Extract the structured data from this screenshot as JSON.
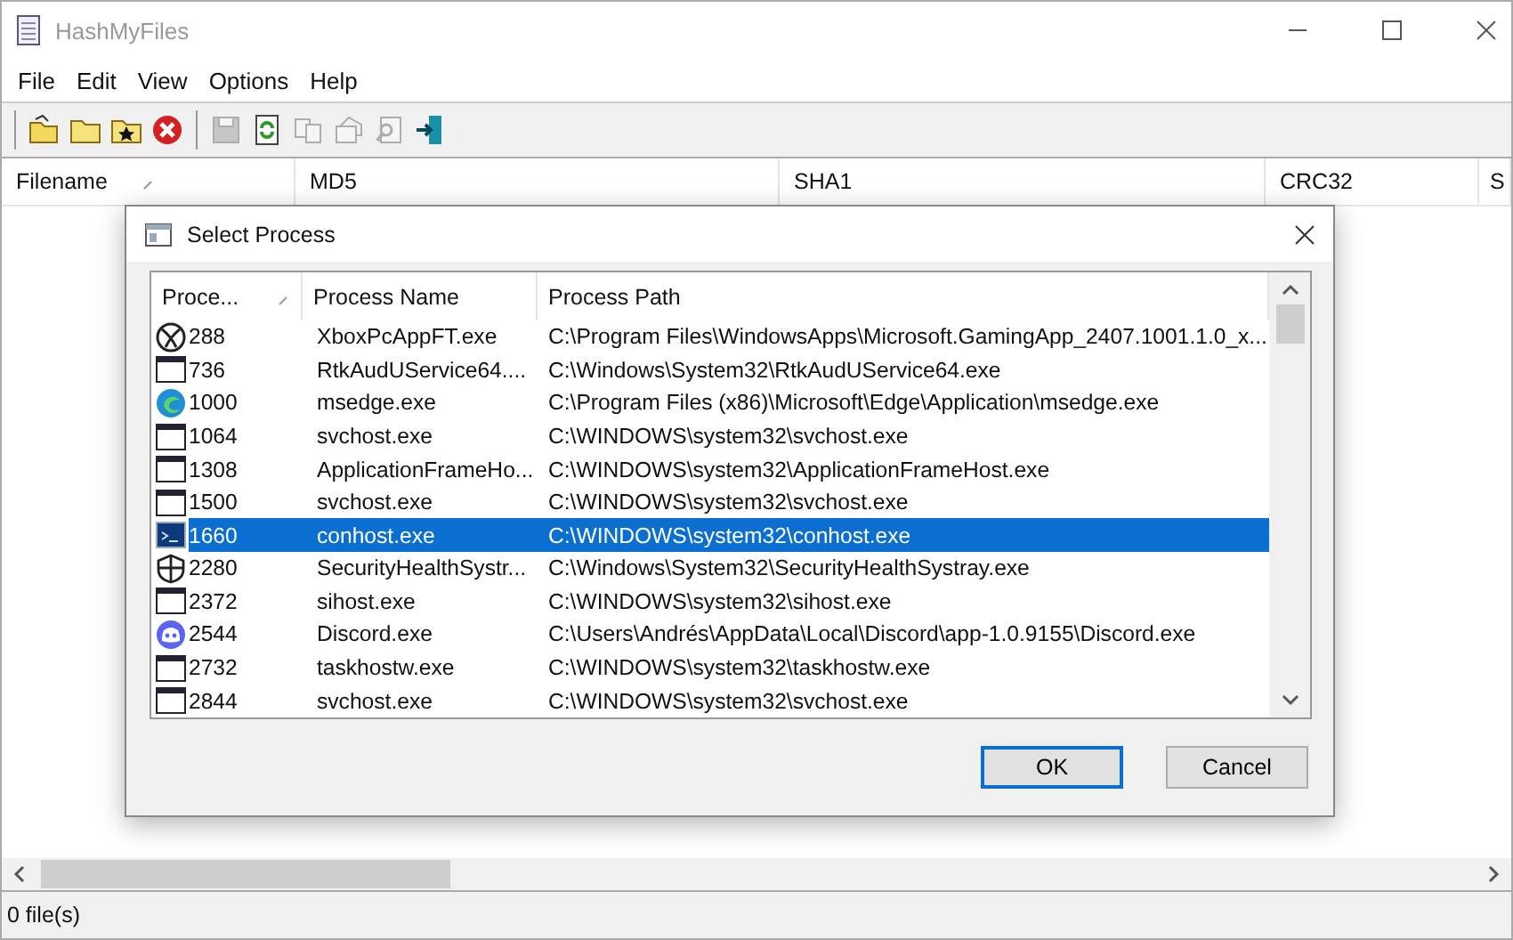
{
  "window": {
    "title": "HashMyFiles"
  },
  "menu": [
    "File",
    "Edit",
    "View",
    "Options",
    "Help"
  ],
  "toolbar": [
    {
      "disabled": false
    },
    {
      "disabled": false
    },
    {
      "disabled": false
    },
    {
      "disabled": false
    },
    {
      "disabled": true
    },
    {
      "disabled": false
    },
    {
      "disabled": true
    },
    {
      "disabled": true
    },
    {
      "disabled": true
    },
    {
      "disabled": false
    }
  ],
  "table": {
    "columns": [
      {
        "label": "Filename",
        "sorted": true
      },
      {
        "label": "MD5",
        "sorted": false
      },
      {
        "label": "SHA1",
        "sorted": false
      },
      {
        "label": "CRC32",
        "sorted": false
      },
      {
        "label": "S"
      }
    ]
  },
  "dialog": {
    "title": "Select Process",
    "columns": [
      {
        "label": "Proce...",
        "sorted": true
      },
      {
        "label": "Process Name",
        "sorted": false
      },
      {
        "label": "Process Path",
        "sorted": false
      }
    ],
    "rows": [
      {
        "kind": "xbox",
        "pid": "288",
        "name": "XboxPcAppFT.exe",
        "path": "C:\\Program Files\\WindowsApps\\Microsoft.GamingApp_2407.1001.1.0_x...",
        "selected": false
      },
      {
        "kind": "window",
        "pid": "736",
        "name": "RtkAudUService64....",
        "path": "C:\\Windows\\System32\\RtkAudUService64.exe",
        "selected": false
      },
      {
        "kind": "edge",
        "pid": "1000",
        "name": "msedge.exe",
        "path": "C:\\Program Files (x86)\\Microsoft\\Edge\\Application\\msedge.exe",
        "selected": false
      },
      {
        "kind": "window",
        "pid": "1064",
        "name": "svchost.exe",
        "path": "C:\\WINDOWS\\system32\\svchost.exe",
        "selected": false
      },
      {
        "kind": "window",
        "pid": "1308",
        "name": "ApplicationFrameHo...",
        "path": "C:\\WINDOWS\\system32\\ApplicationFrameHost.exe",
        "selected": false
      },
      {
        "kind": "window",
        "pid": "1500",
        "name": "svchost.exe",
        "path": "C:\\WINDOWS\\system32\\svchost.exe",
        "selected": false
      },
      {
        "kind": "console",
        "pid": "1660",
        "name": "conhost.exe",
        "path": "C:\\WINDOWS\\system32\\conhost.exe",
        "selected": true
      },
      {
        "kind": "shield",
        "pid": "2280",
        "name": "SecurityHealthSystr...",
        "path": "C:\\Windows\\System32\\SecurityHealthSystray.exe",
        "selected": false
      },
      {
        "kind": "window",
        "pid": "2372",
        "name": "sihost.exe",
        "path": "C:\\WINDOWS\\system32\\sihost.exe",
        "selected": false
      },
      {
        "kind": "discord",
        "pid": "2544",
        "name": "Discord.exe",
        "path": "C:\\Users\\Andrés\\AppData\\Local\\Discord\\app-1.0.9155\\Discord.exe",
        "selected": false
      },
      {
        "kind": "window",
        "pid": "2732",
        "name": "taskhostw.exe",
        "path": "C:\\WINDOWS\\system32\\taskhostw.exe",
        "selected": false
      },
      {
        "kind": "window",
        "pid": "2844",
        "name": "svchost.exe",
        "path": "C:\\WINDOWS\\system32\\svchost.exe",
        "selected": false
      }
    ],
    "buttons": [
      {
        "label": "OK",
        "default": true
      },
      {
        "label": "Cancel",
        "default": false
      }
    ]
  },
  "status_bar": "0 file(s)"
}
